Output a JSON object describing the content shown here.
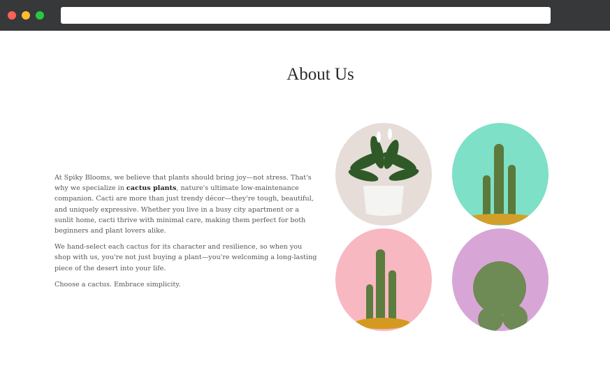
{
  "page": {
    "title": "About Us"
  },
  "about": {
    "p1_a": "At Spiky Blooms, we believe that plants should bring joy—not stress. That's why we specialize in ",
    "p1_bold": "cactus plants",
    "p1_b": ", nature's ultimate low-maintenance companion. Cacti are more than just trendy décor—they're tough, beautiful, and uniquely expressive. Whether you live in a busy city apartment or a sunlit home, cacti thrive with minimal care, making them perfect for both beginners and plant lovers alike.",
    "p2": "We hand-select each cactus for its character and resilience, so when you shop with us, you're not just buying a plant—you're welcoming a long-lasting piece of the desert into your life.",
    "p3": "Choose a cactus. Embrace simplicity."
  },
  "colors": {
    "chrome": "#37383a",
    "close": "#fe5f57",
    "minimize": "#febc2e",
    "maximize": "#28c840",
    "photo1": "#e6ddd8",
    "photo2": "#7ee0c6",
    "photo3": "#f7b8c2",
    "photo4": "#d7a6d6"
  }
}
